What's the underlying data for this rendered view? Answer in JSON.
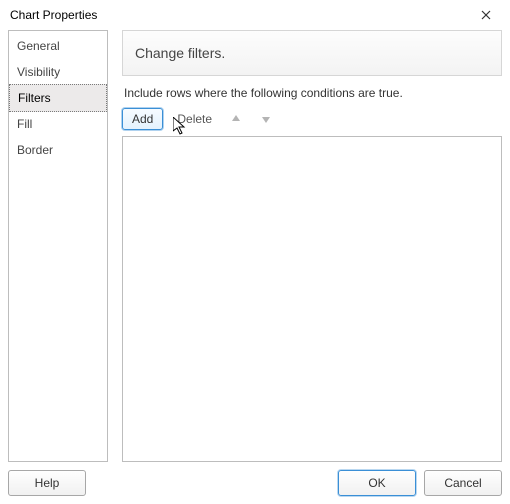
{
  "window": {
    "title": "Chart Properties"
  },
  "sidebar": {
    "items": [
      {
        "label": "General"
      },
      {
        "label": "Visibility"
      },
      {
        "label": "Filters",
        "selected": true
      },
      {
        "label": "Fill"
      },
      {
        "label": "Border"
      }
    ]
  },
  "main": {
    "heading": "Change filters.",
    "instruction": "Include rows where the following conditions are true.",
    "toolbar": {
      "add_label": "Add",
      "delete_label": "Delete",
      "move_up_icon": "arrow-up-icon",
      "move_down_icon": "arrow-down-icon"
    }
  },
  "footer": {
    "help_label": "Help",
    "ok_label": "OK",
    "cancel_label": "Cancel"
  }
}
